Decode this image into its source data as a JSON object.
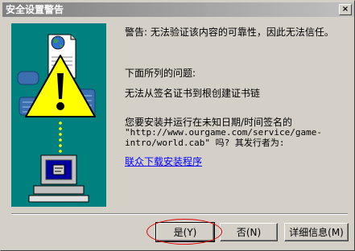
{
  "window": {
    "title": "安全设置警告",
    "close_glyph": "×"
  },
  "message": {
    "warning": "警告: 无法验证该内容的可靠性，因此无法信任。",
    "issues_heading": "下面所列的问题:",
    "issue_1": "无法从签名证书到根创建证书链",
    "question_line1": "您要安装并运行在未知日期/时间签名的",
    "question_line2": "\"http://www.ourgame.com/service/game-",
    "question_line3": "intro/world.cab\" 吗? 其发行者为:",
    "publisher_link": "联众下载安装程序"
  },
  "buttons": {
    "yes": "是(Y)",
    "no": "否(N)",
    "details": "详细信息(M)"
  },
  "colors": {
    "art_background": "#00807f",
    "link": "#0000ff",
    "annotation": "#e00000"
  }
}
